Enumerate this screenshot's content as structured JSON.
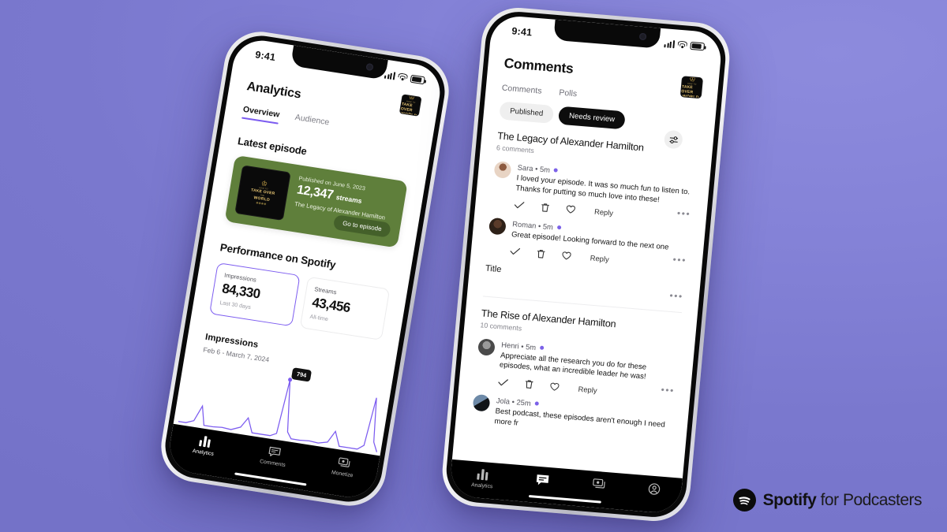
{
  "background_color": "#7f7dd4",
  "brand": {
    "name_bold": "Spotify",
    "name_rest": " for Podcasters",
    "mark": "spotify-logo"
  },
  "podcast_cover": {
    "line1": "HOW TO",
    "line2": "TAKE OVER",
    "line3": "THE",
    "line4": "WORLD"
  },
  "left_phone": {
    "status_bar": {
      "time": "9:41",
      "signal": "signal-icon",
      "wifi": "wifi-icon",
      "battery": "battery-icon"
    },
    "page_title": "Analytics",
    "tabs": [
      {
        "label": "Overview",
        "selected": true
      },
      {
        "label": "Audience",
        "selected": false
      }
    ],
    "latest_episode": {
      "section_title": "Latest episode",
      "published": "Published on June 5, 2023",
      "streams_value": "12,347",
      "streams_label": "streams",
      "episode_name": "The Legacy of Alexander Hamilton",
      "cta": "Go to episode",
      "card_color": "#5f7f3b"
    },
    "performance": {
      "section_title": "Performance on Spotify",
      "cards": [
        {
          "label": "Impressions",
          "value": "84,330",
          "sub": "Last 30 days",
          "selected": true
        },
        {
          "label": "Streams",
          "value": "43,456",
          "sub": "All-time",
          "selected": false
        }
      ]
    },
    "impressions_chart": {
      "title": "Impressions",
      "range": "Feb 6 - March 7, 2024",
      "peak_tooltip": "794",
      "line_color": "#7c5cf0"
    },
    "nav": [
      {
        "label": "Analytics",
        "icon": "bar-chart-icon",
        "selected": true
      },
      {
        "label": "Comments",
        "icon": "comment-icon",
        "selected": false
      },
      {
        "label": "Monetize",
        "icon": "money-icon",
        "selected": false
      }
    ]
  },
  "right_phone": {
    "status_bar": {
      "time": "9:41"
    },
    "page_title": "Comments",
    "tabs": [
      {
        "label": "Comments",
        "selected": true
      },
      {
        "label": "Polls",
        "selected": false
      }
    ],
    "filter_chips": [
      {
        "label": "Published",
        "selected": false
      },
      {
        "label": "Needs review",
        "selected": true
      }
    ],
    "filter_icon": "sliders-icon",
    "episodes": [
      {
        "title": "The Legacy of Alexander Hamilton",
        "comment_count": "6 comments",
        "comments": [
          {
            "author": "Sara",
            "time": "5m",
            "unread": true,
            "text": "I loved your episode. It was so much fun to listen to. Thanks for putting so much love into these!",
            "actions": [
              "approve-check",
              "delete-trash",
              "like-heart",
              "Reply"
            ]
          },
          {
            "author": "Roman",
            "time": "5m",
            "unread": true,
            "text": "Great episode! Looking forward to the next one",
            "actions": [
              "approve-check",
              "delete-trash",
              "like-heart",
              "Reply"
            ]
          }
        ]
      },
      {
        "title": "The Rise of Alexander Hamilton",
        "comment_count": "10 comments",
        "comments": [
          {
            "author": "Henri",
            "time": "5m",
            "unread": true,
            "text": "Appreciate all the research you do for these episodes, what an incredible leader he was!",
            "actions": [
              "approve-check",
              "delete-trash",
              "like-heart",
              "Reply"
            ]
          },
          {
            "author": "Jola",
            "time": "25m",
            "unread": true,
            "text": "Best podcast, these episodes aren't enough I need more fr",
            "actions": []
          }
        ]
      }
    ],
    "title_divider_label": "Title",
    "reply_label": "Reply",
    "overflow_glyph": "•••",
    "nav": [
      {
        "label": "Analytics",
        "icon": "bar-chart-icon",
        "selected": false
      },
      {
        "label": "",
        "icon": "comment-icon",
        "selected": true
      },
      {
        "label": "",
        "icon": "money-icon",
        "selected": false
      },
      {
        "label": "",
        "icon": "profile-icon",
        "selected": false
      }
    ]
  }
}
